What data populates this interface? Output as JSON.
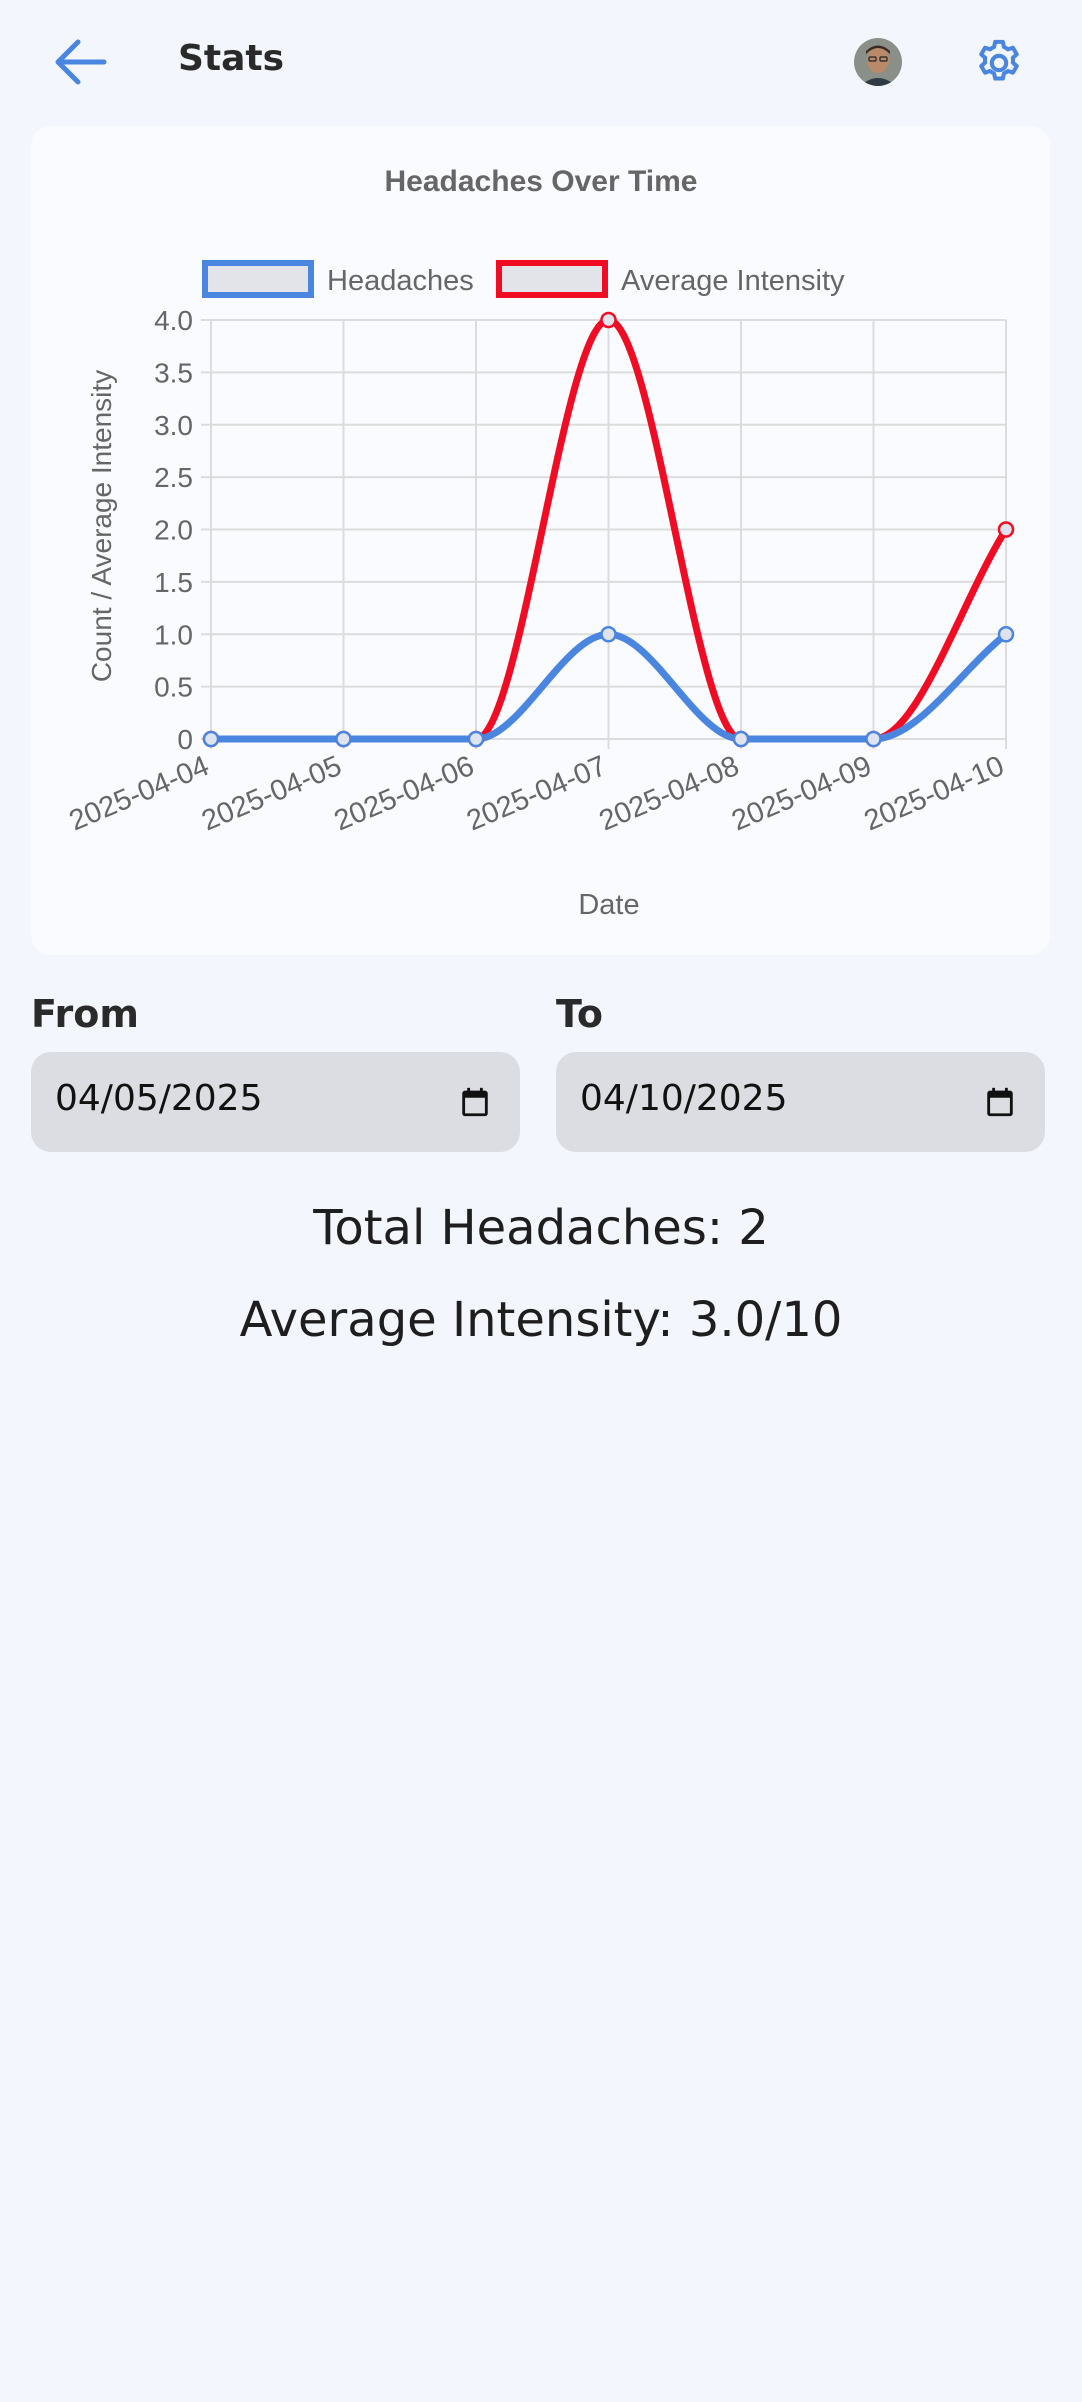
{
  "header": {
    "title": "Stats",
    "back_icon": "arrow-left-icon",
    "settings_icon": "gear-icon",
    "accent": "#4a86e0"
  },
  "chart_data": {
    "type": "line",
    "title": "Headaches Over Time",
    "xlabel": "Date",
    "ylabel": "Count / Average Intensity",
    "categories": [
      "2025-04-04",
      "2025-04-05",
      "2025-04-06",
      "2025-04-07",
      "2025-04-08",
      "2025-04-09",
      "2025-04-10"
    ],
    "series": [
      {
        "name": "Headaches",
        "values": [
          0,
          0,
          0,
          1,
          0,
          0,
          1
        ],
        "color": "#4a86e0"
      },
      {
        "name": "Average Intensity",
        "values": [
          0,
          0,
          0,
          4,
          0,
          0,
          2
        ],
        "color": "#f00d24"
      }
    ],
    "ylim": [
      0,
      4
    ],
    "yticks": [
      "0",
      "0.5",
      "1.0",
      "1.5",
      "2.0",
      "2.5",
      "3.0",
      "3.5",
      "4.0"
    ],
    "grid": true,
    "legend": "top"
  },
  "filters": {
    "from_label": "From",
    "from_value": "04/05/2025",
    "to_label": "To",
    "to_value": "04/10/2025"
  },
  "summary": {
    "total": "Total Headaches: 2",
    "average": "Average Intensity: 3.0/10"
  }
}
